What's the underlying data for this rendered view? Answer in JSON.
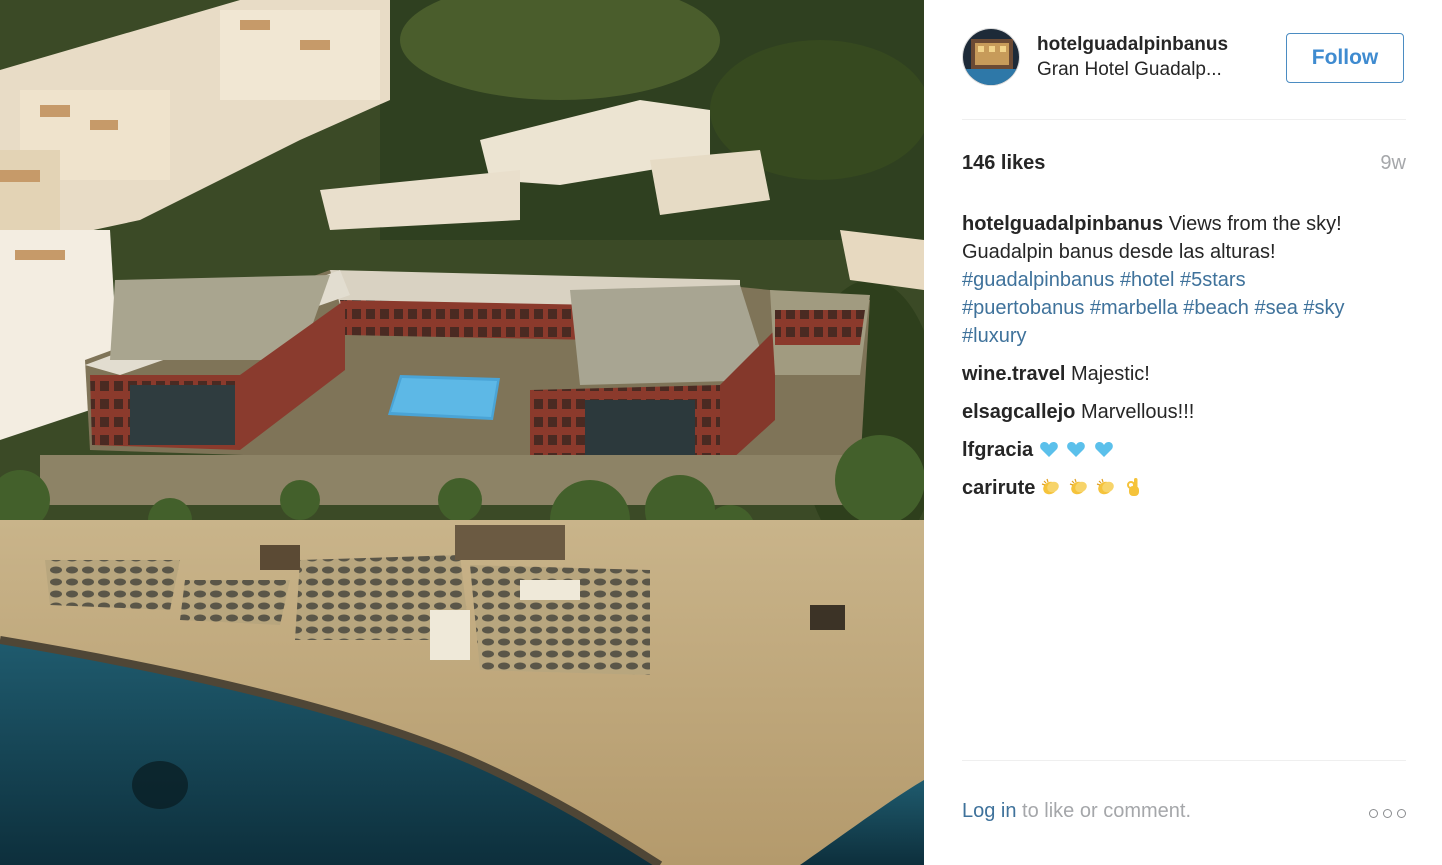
{
  "post": {
    "username": "hotelguadalpinbanus",
    "location": "Gran Hotel Guadalp...",
    "follow_label": "Follow",
    "likes": "146 likes",
    "time_ago": "9w",
    "caption": {
      "author": "hotelguadalpinbanus",
      "text_line1": "Views from the sky!",
      "text_line2": "Guadalpin banus desde las alturas!",
      "hashtags": [
        "#guadalpinbanus",
        "#hotel",
        "#5stars",
        "#puertobanus",
        "#marbella",
        "#beach",
        "#sea",
        "#sky",
        "#luxury"
      ]
    },
    "comments": [
      {
        "author": "wine.travel",
        "text": "Majestic!"
      },
      {
        "author": "elsagcallejo",
        "text": "Marvellous!!!"
      },
      {
        "author": "lfgracia",
        "text": "",
        "emojis": [
          "blue-heart",
          "blue-heart",
          "blue-heart"
        ]
      },
      {
        "author": "carirute",
        "text": "",
        "emojis": [
          "clapping-hands",
          "clapping-hands",
          "clapping-hands",
          "ok-hand"
        ]
      }
    ],
    "login_link": "Log in",
    "login_rest": " to like or comment."
  },
  "colors": {
    "link": "#3f729b",
    "muted": "#a5a7aa",
    "heart": "#5bc0eb",
    "emoji_yellow": "#f5c33b"
  }
}
